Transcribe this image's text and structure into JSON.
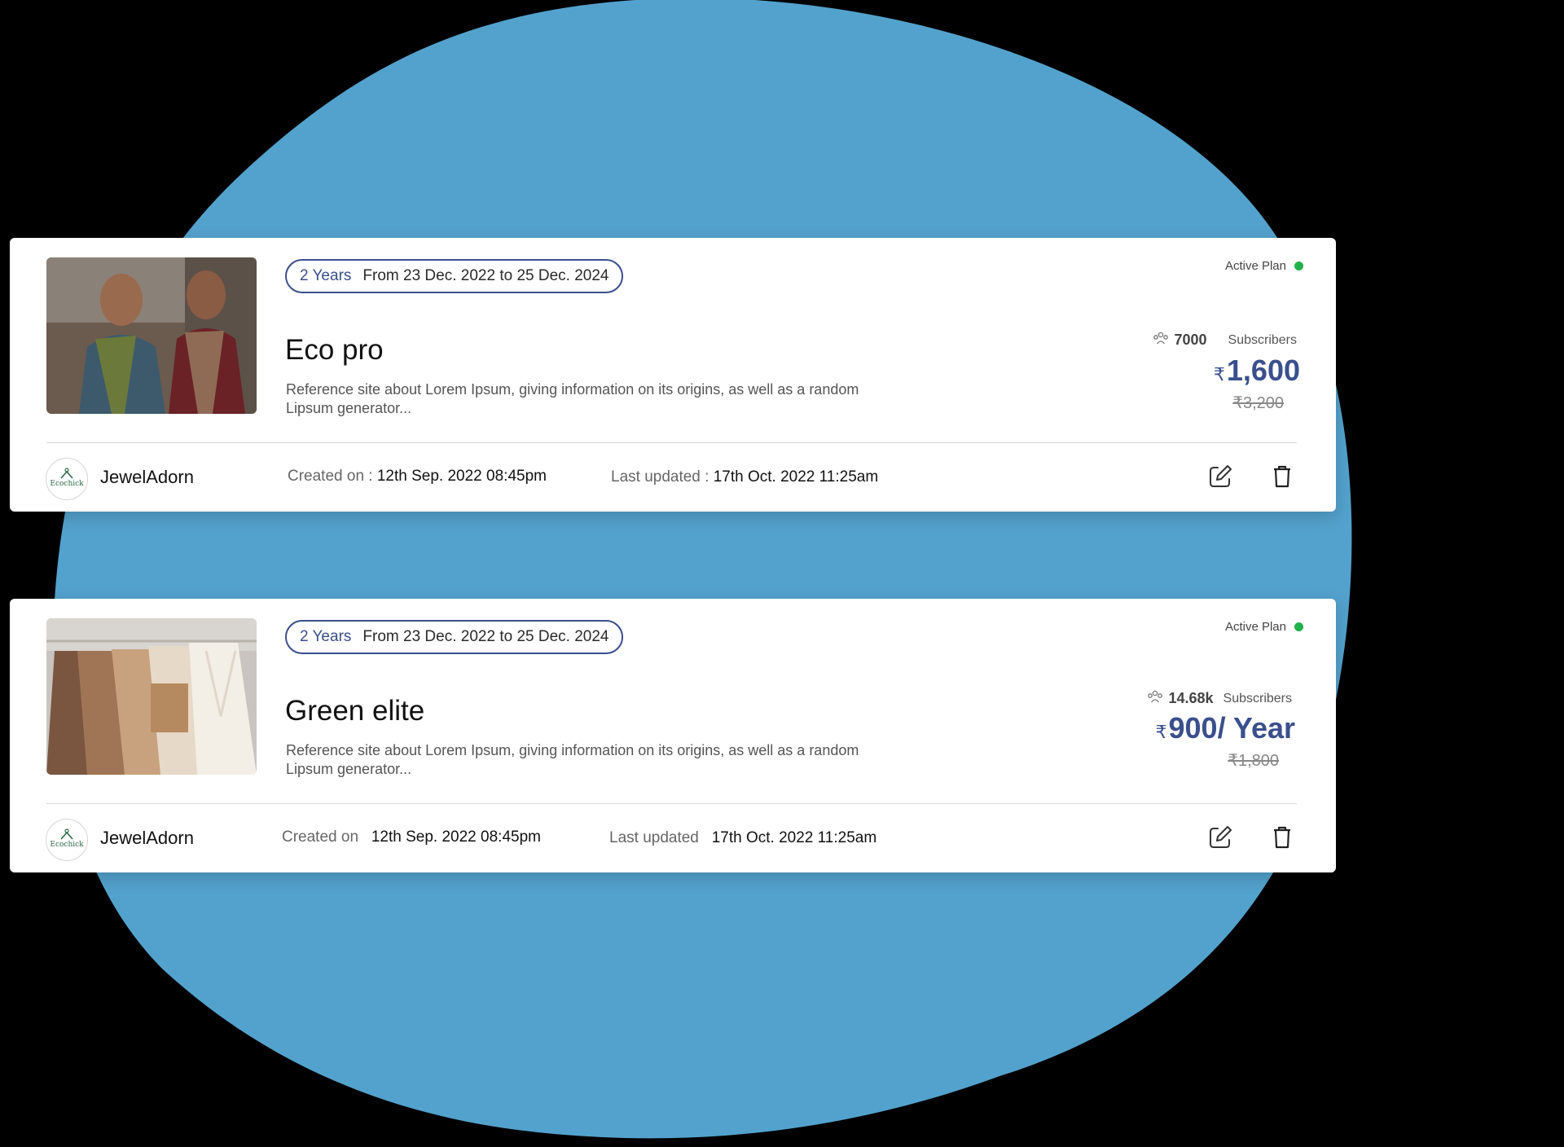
{
  "background": {
    "backdrop": "#000000",
    "blob_color": "#53a2cd"
  },
  "colors": {
    "accent": "#3a4f8c",
    "active_dot": "#21b24b"
  },
  "cards": [
    {
      "image": "scarves-models-photo",
      "duration": "2 Years",
      "range": "From 23 Dec. 2022 to 25 Dec. 2024",
      "title": "Eco pro",
      "description": "Reference site about Lorem Ipsum, giving information on its origins, as well as a random Lipsum generator...",
      "status": "Active Plan",
      "subscribers_count": "7000",
      "subscribers_label": "Subscribers",
      "currency": "₹",
      "price": "1,600",
      "old_price": "₹3,200",
      "brand": "JewelAdorn",
      "brand_logo": "Ecochick",
      "created_label": "Created on :",
      "created_value": "12th Sep. 2022 08:45pm",
      "updated_label": "Last updated :",
      "updated_value": "17th Oct. 2022 11:25am",
      "edit_icon": "edit-icon",
      "delete_icon": "trash-icon"
    },
    {
      "image": "clothing-rack-photo",
      "duration": "2 Years",
      "range": "From 23 Dec. 2022 to 25 Dec. 2024",
      "title": "Green elite",
      "description": "Reference site about Lorem Ipsum, giving information on its origins, as well as a random Lipsum generator...",
      "status": "Active Plan",
      "subscribers_count": "14.68k",
      "subscribers_label": "Subscribers",
      "currency": "₹",
      "price": "900/ Year",
      "old_price": "₹1,800",
      "brand": "JewelAdorn",
      "brand_logo": "Ecochick",
      "created_label": "Created on",
      "created_value": "12th Sep. 2022 08:45pm",
      "updated_label": "Last updated",
      "updated_value": "17th Oct. 2022 11:25am",
      "edit_icon": "edit-icon",
      "delete_icon": "trash-icon"
    }
  ]
}
